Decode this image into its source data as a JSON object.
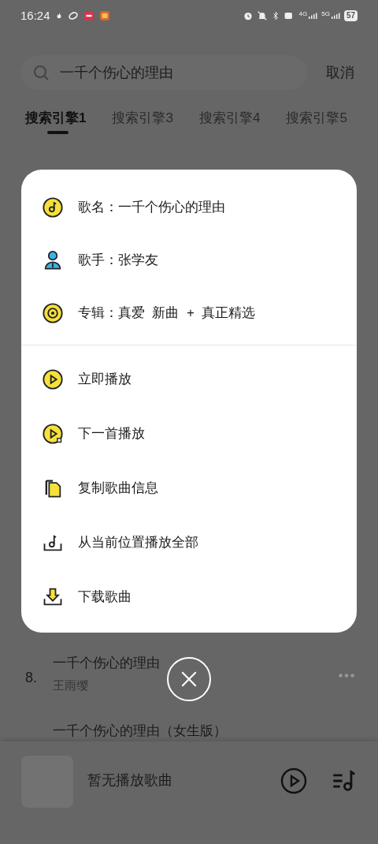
{
  "status_bar": {
    "time": "16:24",
    "network_labels": [
      "4G",
      "5G"
    ],
    "battery": "57"
  },
  "search": {
    "value": "一千个伤心的理由",
    "cancel": "取消"
  },
  "tabs": [
    {
      "label": "搜索引擎1",
      "selected": true
    },
    {
      "label": "搜索引擎3",
      "selected": false
    },
    {
      "label": "搜索引擎4",
      "selected": false
    },
    {
      "label": "搜索引擎5",
      "selected": false
    }
  ],
  "sheet": {
    "info": [
      {
        "kind": "song",
        "text": "歌名：一千个伤心的理由"
      },
      {
        "kind": "singer",
        "text": "歌手：张学友"
      },
      {
        "kind": "album",
        "text": "专辑：真爱  新曲  +  真正精选"
      }
    ],
    "actions": [
      {
        "kind": "play",
        "label": "立即播放"
      },
      {
        "kind": "next",
        "label": "下一首播放"
      },
      {
        "kind": "copy",
        "label": "复制歌曲信息"
      },
      {
        "kind": "playall",
        "label": "从当前位置播放全部"
      },
      {
        "kind": "download",
        "label": "下载歌曲"
      }
    ]
  },
  "results": [
    {
      "number": "8.",
      "title": "一千个伤心的理由",
      "artist": "王雨缨"
    },
    {
      "title": "一千个伤心的理由（女生版）"
    }
  ],
  "player": {
    "title": "暂无播放歌曲"
  }
}
